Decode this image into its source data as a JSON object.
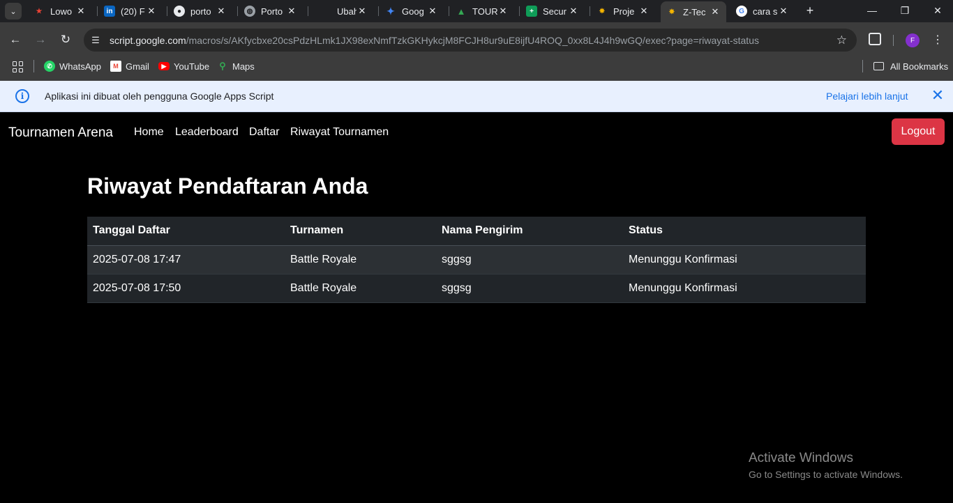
{
  "browser": {
    "tabs": [
      {
        "title": "Lowo",
        "icon": "star-icon",
        "color": "#e94235"
      },
      {
        "title": "(20) F",
        "icon": "linkedin-icon",
        "color": "#0a66c2"
      },
      {
        "title": "porto",
        "icon": "github-icon",
        "color": "#e8eaed"
      },
      {
        "title": "Porto",
        "icon": "globe-icon",
        "color": "#9aa0a6"
      },
      {
        "title": "Ubah",
        "icon": "",
        "color": ""
      },
      {
        "title": "Goog",
        "icon": "gemini-icon",
        "color": "#4285f4"
      },
      {
        "title": "TOUR",
        "icon": "drive-icon",
        "color": "#34a853"
      },
      {
        "title": "Secur",
        "icon": "sheets-icon",
        "color": "#0f9d58"
      },
      {
        "title": "Proje",
        "icon": "apps-script-icon",
        "color": "#f4b400"
      },
      {
        "title": "Z-Tec",
        "icon": "apps-script-icon",
        "color": "#f4b400",
        "active": true
      },
      {
        "title": "cara s",
        "icon": "google-icon",
        "color": "#4285f4"
      }
    ],
    "url_host": "script.google.com",
    "url_path": "/macros/s/AKfycbxe20csPdzHLmk1JX98exNmfTzkGKHykcjM8FCJH8ur9uE8ijfU4ROQ_0xx8L4J4h9wGQ/exec?page=riwayat-status",
    "profile_initial": "F",
    "bookmarks": [
      {
        "label": "WhatsApp",
        "icon": "whatsapp-icon"
      },
      {
        "label": "Gmail",
        "icon": "gmail-icon"
      },
      {
        "label": "YouTube",
        "icon": "youtube-icon"
      },
      {
        "label": "Maps",
        "icon": "maps-icon"
      }
    ],
    "all_bookmarks": "All Bookmarks"
  },
  "infobar": {
    "message": "Aplikasi ini dibuat oleh pengguna Google Apps Script",
    "link": "Pelajari lebih lanjut"
  },
  "app": {
    "brand": "Tournamen Arena",
    "nav": [
      "Home",
      "Leaderboard",
      "Daftar",
      "Riwayat Tournamen"
    ],
    "logout": "Logout",
    "logout_color": "#dc3545",
    "title": "Riwayat Pendaftaran Anda",
    "table": {
      "headers": [
        "Tanggal Daftar",
        "Turnamen",
        "Nama Pengirim",
        "Status"
      ],
      "rows": [
        [
          "2025-07-08 17:47",
          "Battle Royale",
          "sggsg",
          "Menunggu Konfirmasi"
        ],
        [
          "2025-07-08 17:50",
          "Battle Royale",
          "sggsg",
          "Menunggu Konfirmasi"
        ]
      ]
    }
  },
  "watermark": {
    "line1": "Activate Windows",
    "line2": "Go to Settings to activate Windows."
  }
}
